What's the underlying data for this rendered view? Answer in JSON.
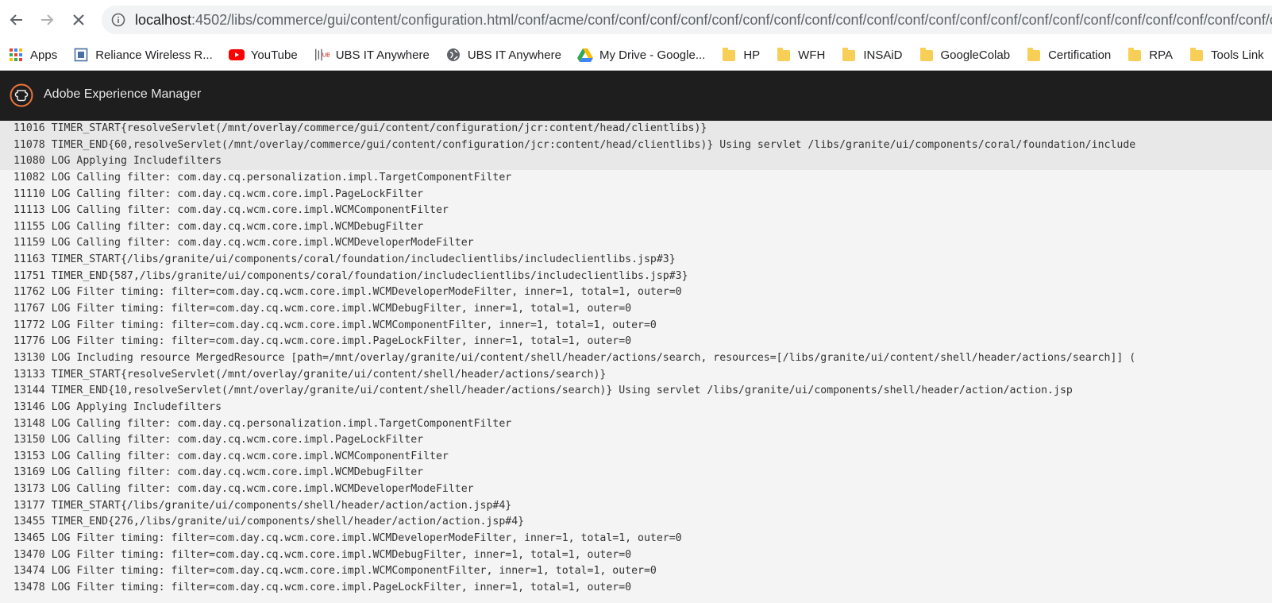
{
  "browser": {
    "url_host": "localhost",
    "url_rest": ":4502/libs/commerce/gui/content/configuration.html/conf/acme/conf/conf/conf/conf/conf/conf/conf/conf/conf/conf/conf/conf/conf/conf/conf/conf/conf/conf/conf/conf/conf/conf/conf"
  },
  "bookmarks": [
    {
      "label": "Apps",
      "icon": "apps-grid-icon"
    },
    {
      "label": "Reliance Wireless R...",
      "icon": "page-icon"
    },
    {
      "label": "YouTube",
      "icon": "youtube-icon"
    },
    {
      "label": "UBS IT Anywhere",
      "icon": "ubs-icon"
    },
    {
      "label": "UBS IT Anywhere",
      "icon": "globe-icon"
    },
    {
      "label": "My Drive - Google...",
      "icon": "google-drive-icon"
    },
    {
      "label": "HP",
      "icon": "folder-icon"
    },
    {
      "label": "WFH",
      "icon": "folder-icon"
    },
    {
      "label": "INSAiD",
      "icon": "folder-icon"
    },
    {
      "label": "GoogleColab",
      "icon": "folder-icon"
    },
    {
      "label": "Certification",
      "icon": "folder-icon"
    },
    {
      "label": "RPA",
      "icon": "folder-icon"
    },
    {
      "label": "Tools Link",
      "icon": "folder-icon"
    }
  ],
  "app": {
    "title": "Adobe Experience Manager",
    "accent": "#e8763b"
  },
  "log_lines": [
    "11016 TIMER_START{resolveServlet(/mnt/overlay/commerce/gui/content/configuration/jcr:content/head/clientlibs)}",
    "11078 TIMER_END{60,resolveServlet(/mnt/overlay/commerce/gui/content/configuration/jcr:content/head/clientlibs)} Using servlet /libs/granite/ui/components/coral/foundation/include",
    "11080 LOG Applying Includefilters",
    "11082 LOG Calling filter: com.day.cq.personalization.impl.TargetComponentFilter",
    "11110 LOG Calling filter: com.day.cq.wcm.core.impl.PageLockFilter",
    "11113 LOG Calling filter: com.day.cq.wcm.core.impl.WCMComponentFilter",
    "11155 LOG Calling filter: com.day.cq.wcm.core.impl.WCMDebugFilter",
    "11159 LOG Calling filter: com.day.cq.wcm.core.impl.WCMDeveloperModeFilter",
    "11163 TIMER_START{/libs/granite/ui/components/coral/foundation/includeclientlibs/includeclientlibs.jsp#3}",
    "11751 TIMER_END{587,/libs/granite/ui/components/coral/foundation/includeclientlibs/includeclientlibs.jsp#3}",
    "11762 LOG Filter timing: filter=com.day.cq.wcm.core.impl.WCMDeveloperModeFilter, inner=1, total=1, outer=0",
    "11767 LOG Filter timing: filter=com.day.cq.wcm.core.impl.WCMDebugFilter, inner=1, total=1, outer=0",
    "11772 LOG Filter timing: filter=com.day.cq.wcm.core.impl.WCMComponentFilter, inner=1, total=1, outer=0",
    "11776 LOG Filter timing: filter=com.day.cq.wcm.core.impl.PageLockFilter, inner=1, total=1, outer=0",
    "13130 LOG Including resource MergedResource [path=/mnt/overlay/granite/ui/content/shell/header/actions/search, resources=[/libs/granite/ui/content/shell/header/actions/search]] (",
    "13133 TIMER_START{resolveServlet(/mnt/overlay/granite/ui/content/shell/header/actions/search)}",
    "13144 TIMER_END{10,resolveServlet(/mnt/overlay/granite/ui/content/shell/header/actions/search)} Using servlet /libs/granite/ui/components/shell/header/action/action.jsp",
    "13146 LOG Applying Includefilters",
    "13148 LOG Calling filter: com.day.cq.personalization.impl.TargetComponentFilter",
    "13150 LOG Calling filter: com.day.cq.wcm.core.impl.PageLockFilter",
    "13153 LOG Calling filter: com.day.cq.wcm.core.impl.WCMComponentFilter",
    "13169 LOG Calling filter: com.day.cq.wcm.core.impl.WCMDebugFilter",
    "13173 LOG Calling filter: com.day.cq.wcm.core.impl.WCMDeveloperModeFilter",
    "13177 TIMER_START{/libs/granite/ui/components/shell/header/action/action.jsp#4}",
    "13455 TIMER_END{276,/libs/granite/ui/components/shell/header/action/action.jsp#4}",
    "13465 LOG Filter timing: filter=com.day.cq.wcm.core.impl.WCMDeveloperModeFilter, inner=1, total=1, outer=0",
    "13470 LOG Filter timing: filter=com.day.cq.wcm.core.impl.WCMDebugFilter, inner=1, total=1, outer=0",
    "13474 LOG Filter timing: filter=com.day.cq.wcm.core.impl.WCMComponentFilter, inner=1, total=1, outer=0",
    "13478 LOG Filter timing: filter=com.day.cq.wcm.core.impl.PageLockFilter, inner=1, total=1, outer=0"
  ]
}
